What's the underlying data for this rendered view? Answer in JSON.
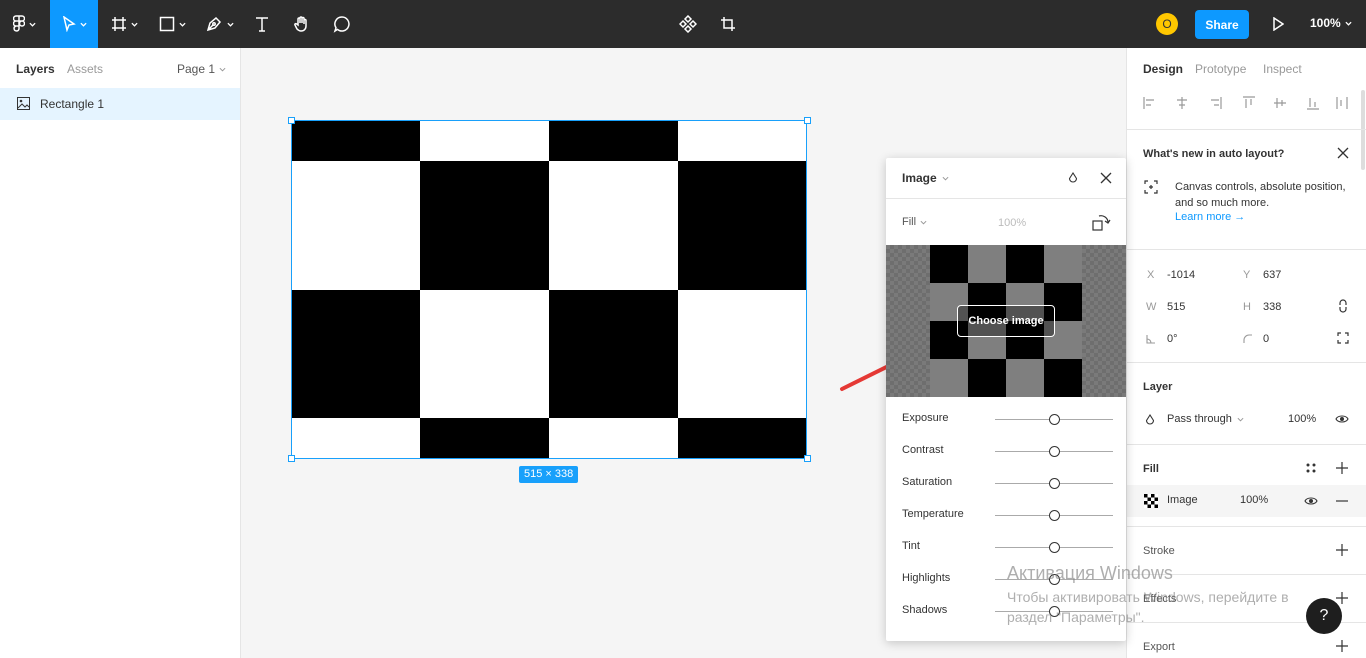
{
  "toolbar": {
    "share_label": "Share",
    "zoom_label": "100%",
    "avatar_initial": "O",
    "tools": [
      "main-menu-icon",
      "move-icon",
      "frame-icon",
      "shape-icon",
      "pen-icon",
      "text-icon",
      "hand-icon",
      "comment-icon"
    ],
    "center_tools": [
      "component-icon",
      "crop-icon"
    ],
    "accent": "#0d99ff"
  },
  "left_panel": {
    "tabs": [
      "Layers",
      "Assets"
    ],
    "page_label": "Page 1",
    "layers": [
      {
        "name": "Rectangle 1",
        "icon": "image-layer-icon"
      }
    ]
  },
  "canvas": {
    "size_badge": "515 × 338"
  },
  "image_popover": {
    "title": "Image",
    "fill_mode": "Fill",
    "opacity": "100%",
    "choose_image_label": "Choose image",
    "adjustments": [
      {
        "name": "Exposure",
        "value": 0.5
      },
      {
        "name": "Contrast",
        "value": 0.5
      },
      {
        "name": "Saturation",
        "value": 0.5
      },
      {
        "name": "Temperature",
        "value": 0.5
      },
      {
        "name": "Tint",
        "value": 0.5
      },
      {
        "name": "Highlights",
        "value": 0.5
      },
      {
        "name": "Shadows",
        "value": 0.5
      }
    ]
  },
  "right_panel": {
    "tabs": [
      "Design",
      "Prototype",
      "Inspect"
    ],
    "whats_new": {
      "title": "What's new in auto layout?",
      "body": "Canvas controls, absolute position, and so much more.",
      "link": "Learn more →"
    },
    "geometry": {
      "x_label": "X",
      "x": "-1014",
      "y_label": "Y",
      "y": "637",
      "w_label": "W",
      "w": "515",
      "h_label": "H",
      "h": "338",
      "rotation": "0°",
      "radius": "0"
    },
    "layer": {
      "title": "Layer",
      "blend": "Pass through",
      "opacity": "100%"
    },
    "fill": {
      "title": "Fill",
      "type": "Image",
      "opacity": "100%"
    },
    "stroke_title": "Stroke",
    "effects_title": "Effects",
    "export_title": "Export"
  },
  "watermark": {
    "line1": "Активация Windows",
    "line2": "Чтобы активировать Windows, перейдите в",
    "line3": "раздел \"Параметры\"."
  },
  "help_label": "?"
}
